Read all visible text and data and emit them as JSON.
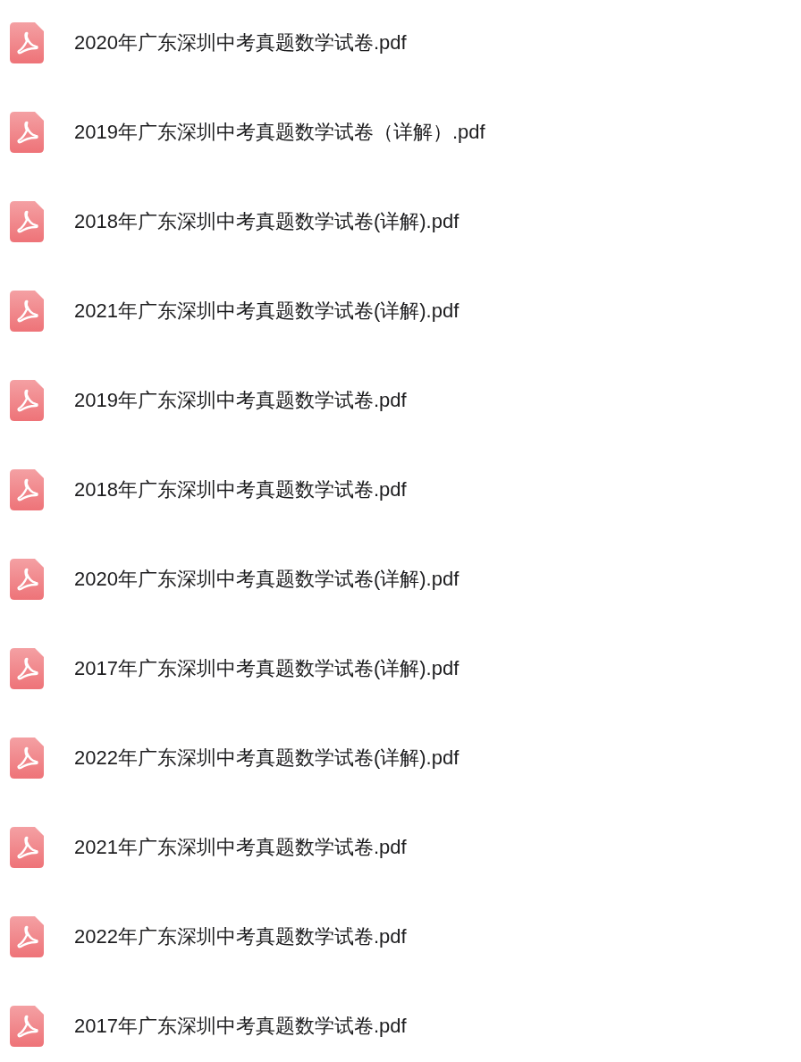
{
  "files": [
    {
      "name": "2020年广东深圳中考真题数学试卷.pdf",
      "kind": "pdf"
    },
    {
      "name": "2019年广东深圳中考真题数学试卷（详解）.pdf",
      "kind": "pdf"
    },
    {
      "name": "2018年广东深圳中考真题数学试卷(详解).pdf",
      "kind": "pdf"
    },
    {
      "name": "2021年广东深圳中考真题数学试卷(详解).pdf",
      "kind": "pdf"
    },
    {
      "name": "2019年广东深圳中考真题数学试卷.pdf",
      "kind": "pdf"
    },
    {
      "name": "2018年广东深圳中考真题数学试卷.pdf",
      "kind": "pdf"
    },
    {
      "name": "2020年广东深圳中考真题数学试卷(详解).pdf",
      "kind": "pdf"
    },
    {
      "name": "2017年广东深圳中考真题数学试卷(详解).pdf",
      "kind": "pdf"
    },
    {
      "name": "2022年广东深圳中考真题数学试卷(详解).pdf",
      "kind": "pdf"
    },
    {
      "name": "2021年广东深圳中考真题数学试卷.pdf",
      "kind": "pdf"
    },
    {
      "name": "2022年广东深圳中考真题数学试卷.pdf",
      "kind": "pdf"
    },
    {
      "name": "2017年广东深圳中考真题数学试卷.pdf",
      "kind": "pdf"
    }
  ]
}
